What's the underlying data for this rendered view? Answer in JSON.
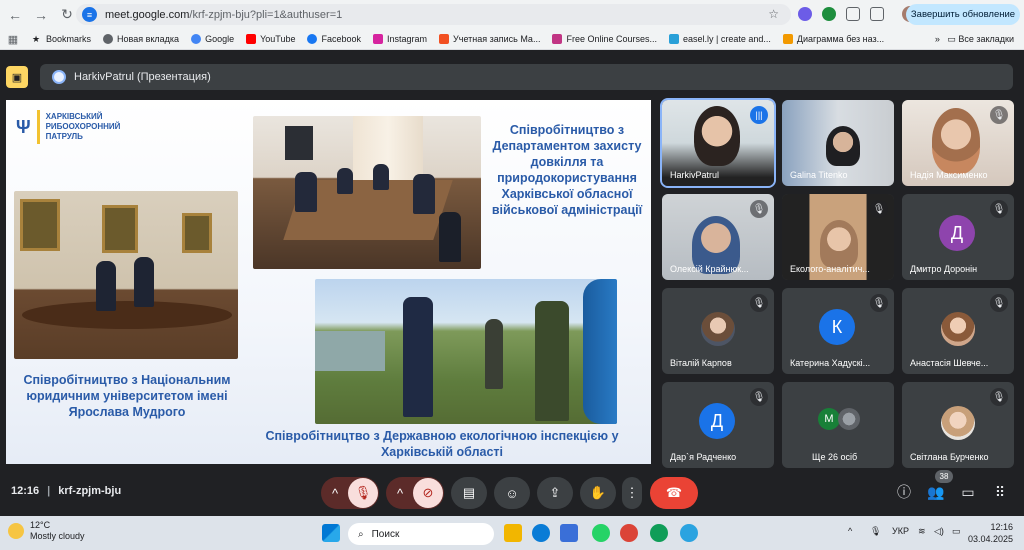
{
  "browser": {
    "url_host": "meet.google.com",
    "url_path": "/krf-zpjm-bju?pli=1&authuser=1",
    "update_button": "Завершить обновление",
    "bookmarks": [
      {
        "label": "Bookmarks",
        "color": "#202124"
      },
      {
        "label": "Новая вкладка",
        "color": "#5f6368"
      },
      {
        "label": "Google",
        "color": "#4285f4"
      },
      {
        "label": "YouTube",
        "color": "#ff0000"
      },
      {
        "label": "Facebook",
        "color": "#1877f2"
      },
      {
        "label": "Instagram",
        "color": "#d6249f"
      },
      {
        "label": "Учетная запись Ма...",
        "color": "#f25022"
      },
      {
        "label": "Free Online Courses...",
        "color": "#c13584"
      },
      {
        "label": "easel.ly | create and...",
        "color": "#29a0d8"
      },
      {
        "label": "Диаграмма без наз...",
        "color": "#f29900"
      }
    ],
    "all_bookmarks": "Все закладки"
  },
  "meet": {
    "presentation_title": "HarkivPatrul (Презентация)",
    "time": "12:16",
    "meeting_code": "krf-zpjm-bju",
    "participants_count": "38",
    "participants": [
      {
        "name": "HarkivPatrul",
        "type": "video",
        "speaking": true
      },
      {
        "name": "Galina Titenko",
        "type": "video",
        "muted": false
      },
      {
        "name": "Надія Максименко",
        "type": "video",
        "muted": true
      },
      {
        "name": "Олексій Крайнюк...",
        "type": "video",
        "muted": true
      },
      {
        "name": "Еколого-аналітич...",
        "type": "video",
        "muted": true
      },
      {
        "name": "Дмитро Доронін",
        "type": "letter",
        "letter": "Д",
        "color": "#8e44ad",
        "muted": true
      },
      {
        "name": "Віталій Карпов",
        "type": "photo",
        "muted": true
      },
      {
        "name": "Катерина Хадускі...",
        "type": "letter",
        "letter": "К",
        "color": "#1a73e8",
        "muted": true
      },
      {
        "name": "Анастасія Шевче...",
        "type": "photo",
        "muted": true
      },
      {
        "name": "Дар`я Радченко",
        "type": "letter",
        "letter": "Д",
        "color": "#1a73e8",
        "muted": true
      },
      {
        "name": "Ще 26 осіб",
        "type": "group",
        "letter": "M",
        "color": "#188038"
      },
      {
        "name": "Світлана Бурченко",
        "type": "photo",
        "muted": true
      }
    ]
  },
  "slide": {
    "logo_text": "ХАРКІВСЬКИЙ\nРИБООХОРОННИЙ\nПАТРУЛЬ",
    "caption_1": "Співробітництво з Національним юридичним університетом імені Ярослава Мудрого",
    "caption_2": "Співробітництво з Департаментом захисту довкілля та природокористування Харківської обласної військової адміністрації",
    "caption_3": "Співробітництво з Державною екологічною інспекцією у Харківській області"
  },
  "taskbar": {
    "temperature": "12°C",
    "weather": "Mostly cloudy",
    "search_placeholder": "Поиск",
    "lang": "УКР",
    "time": "12:16",
    "date": "03.04.2025"
  }
}
